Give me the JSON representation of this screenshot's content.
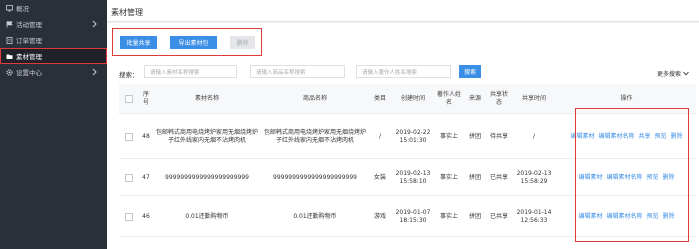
{
  "sidebar": {
    "items": [
      {
        "label": "概况",
        "icon": "monitor-icon",
        "has_arrow": false,
        "active": false
      },
      {
        "label": "活动管理",
        "icon": "flag-icon",
        "has_arrow": true,
        "active": false
      },
      {
        "label": "订单管理",
        "icon": "document-icon",
        "has_arrow": false,
        "active": false
      },
      {
        "label": "素材管理",
        "icon": "folder-icon",
        "has_arrow": false,
        "active": true
      },
      {
        "label": "设置中心",
        "icon": "gear-icon",
        "has_arrow": true,
        "active": false
      }
    ]
  },
  "header": {
    "title": "素材管理"
  },
  "toolbar": {
    "batch_share": "批量共享",
    "export_package": "导出素材包",
    "delete": "删除"
  },
  "search": {
    "label": "搜索：",
    "material_placeholder": "请输入素材名称搜索",
    "product_placeholder": "请输入商品名称搜索",
    "author_placeholder": "请输入著作人姓名搜索",
    "button": "搜索",
    "more": "更多搜索"
  },
  "table": {
    "headers": [
      "序号",
      "素材名称",
      "商品名称",
      "类目",
      "创建时间",
      "著作人姓名",
      "来源",
      "共享状态",
      "共享时间",
      "操作"
    ],
    "rows": [
      {
        "index": "48",
        "material": "包邮韩式商用电烧烤炉家用无烟烧烤炉子红外线家内无烟不沾烤肉机",
        "product": "包邮韩式商用电烧烤炉家用无烟烧烤炉子红外线家内无烟不沾烤肉机",
        "category": "/",
        "created": "2019-02-22 15:01:30",
        "author": "事实上",
        "source": "拼团",
        "share_status": "待共享",
        "share_time": "/",
        "ops": [
          "编辑素材",
          "编辑素材名称",
          "共享",
          "预览",
          "删除"
        ]
      },
      {
        "index": "47",
        "material": "9999999999999999999999",
        "product": "9999999999999999999999",
        "category": "女装",
        "created": "2019-02-13 15:58:10",
        "author": "事实上",
        "source": "拼团",
        "share_status": "已共享",
        "share_time": "2019-02-13 15:58:29",
        "ops": [
          "编辑素材",
          "编辑素材名称",
          "预览",
          "删除"
        ]
      },
      {
        "index": "46",
        "material": "0.01还勤购物币",
        "product": "0.01还勤购物币",
        "category": "游戏",
        "created": "2019-01-07 18:15:30",
        "author": "事实上",
        "source": "拼团",
        "share_status": "已共享",
        "share_time": "2019-01-14 12:56:33",
        "ops": [
          "编辑素材",
          "编辑素材名称",
          "预览",
          "删除"
        ]
      }
    ]
  },
  "colors": {
    "sidebar_bg": "#2b2f3a",
    "primary": "#3a8ee6",
    "highlight": "#e03b3b"
  }
}
